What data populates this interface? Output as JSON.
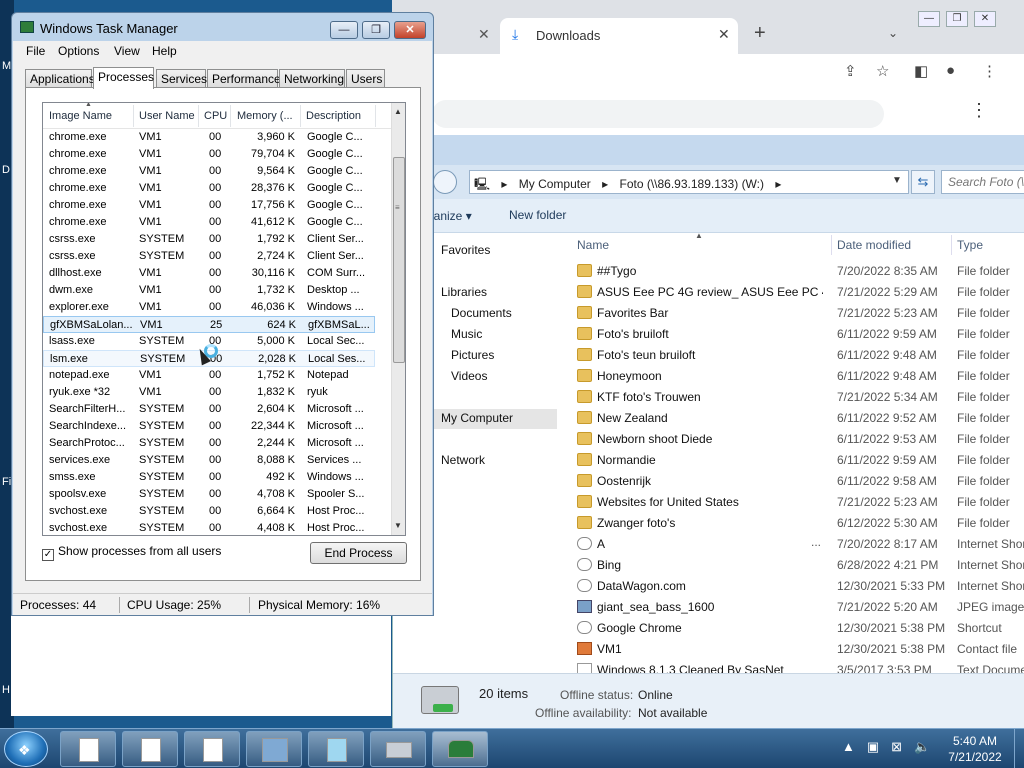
{
  "chrome": {
    "tab_title": "Downloads",
    "tab_close": "✕",
    "prev_tab_close": "✕",
    "new_tab": "+",
    "tab_menu": "⌄",
    "kebab": "⋮",
    "win_min": "—",
    "win_max": "❐",
    "win_close": "✕"
  },
  "explorer": {
    "breadcrumbs": [
      "My Computer",
      "▸",
      "Foto (\\\\86.93.189.133) (W:)",
      "▸"
    ],
    "breadcrumb_root_arrow": "▸",
    "search_placeholder": "Search Foto (\\\\...",
    "organize": "rganize ▾",
    "new_folder": "New folder",
    "nav": {
      "favorites": "Favorites",
      "libraries": "Libraries",
      "documents": "Documents",
      "music": "Music",
      "pictures": "Pictures",
      "videos": "Videos",
      "my_computer": "My Computer",
      "network": "Network"
    },
    "columns": {
      "name": "Name",
      "date": "Date modified",
      "type": "Type"
    },
    "files": [
      {
        "name": "##Tygo",
        "date": "7/20/2022 8:35 AM",
        "type": "File folder",
        "icon": "folder"
      },
      {
        "name": "ASUS Eee PC 4G review_ ASUS Eee PC 4G ...",
        "date": "7/21/2022 5:29 AM",
        "type": "File folder",
        "icon": "folder"
      },
      {
        "name": "Favorites Bar",
        "date": "7/21/2022 5:23 AM",
        "type": "File folder",
        "icon": "folder"
      },
      {
        "name": "Foto's bruiloft",
        "date": "6/11/2022 9:59 AM",
        "type": "File folder",
        "icon": "folder"
      },
      {
        "name": "Foto's teun bruiloft",
        "date": "6/11/2022 9:48 AM",
        "type": "File folder",
        "icon": "folder"
      },
      {
        "name": "Honeymoon",
        "date": "6/11/2022 9:48 AM",
        "type": "File folder",
        "icon": "folder"
      },
      {
        "name": "KTF foto's Trouwen",
        "date": "7/21/2022 5:34 AM",
        "type": "File folder",
        "icon": "folder"
      },
      {
        "name": "New Zealand",
        "date": "6/11/2022 9:52 AM",
        "type": "File folder",
        "icon": "folder"
      },
      {
        "name": "Newborn shoot Diede",
        "date": "6/11/2022 9:53 AM",
        "type": "File folder",
        "icon": "folder"
      },
      {
        "name": "Normandie",
        "date": "6/11/2022 9:59 AM",
        "type": "File folder",
        "icon": "folder"
      },
      {
        "name": "Oostenrijk",
        "date": "6/11/2022 9:58 AM",
        "type": "File folder",
        "icon": "folder"
      },
      {
        "name": "Websites for United States",
        "date": "7/21/2022 5:23 AM",
        "type": "File folder",
        "icon": "folder"
      },
      {
        "name": "Zwanger foto's",
        "date": "6/12/2022 5:30 AM",
        "type": "File folder",
        "icon": "folder"
      },
      {
        "name": "A",
        "date": "7/20/2022 8:17 AM",
        "type": "Internet Shor",
        "icon": "link",
        "more": "..."
      },
      {
        "name": "Bing",
        "date": "6/28/2022 4:21 PM",
        "type": "Internet Shor",
        "icon": "link"
      },
      {
        "name": "DataWagon.com",
        "date": "12/30/2021 5:33 PM",
        "type": "Internet Shor",
        "icon": "link"
      },
      {
        "name": "giant_sea_bass_1600",
        "date": "7/21/2022 5:20 AM",
        "type": "JPEG image",
        "icon": "img"
      },
      {
        "name": "Google Chrome",
        "date": "12/30/2021 5:38 PM",
        "type": "Shortcut",
        "icon": "link"
      },
      {
        "name": "VM1",
        "date": "12/30/2021 5:38 PM",
        "type": "Contact file",
        "icon": "contact"
      },
      {
        "name": "Windows 8.1.3 Cleaned By SasNet",
        "date": "3/5/2017 3:53 PM",
        "type": "Text Docume",
        "icon": "doc"
      }
    ],
    "details": {
      "count": "20 items",
      "offline_status_label": "Offline status:",
      "offline_status_value": "Online",
      "offline_avail_label": "Offline availability:",
      "offline_avail_value": "Not available"
    }
  },
  "taskmgr": {
    "title": "Windows Task Manager",
    "win_min": "—",
    "win_max": "❐",
    "win_close": "✕",
    "menu": [
      "File",
      "Options",
      "View",
      "Help"
    ],
    "tabs": [
      "Applications",
      "Processes",
      "Services",
      "Performance",
      "Networking",
      "Users"
    ],
    "columns": [
      "Image Name",
      "User Name",
      "CPU",
      "Memory (...",
      "Description"
    ],
    "processes": [
      [
        "chrome.exe",
        "VM1",
        "00",
        "3,960 K",
        "Google C..."
      ],
      [
        "chrome.exe",
        "VM1",
        "00",
        "79,704 K",
        "Google C..."
      ],
      [
        "chrome.exe",
        "VM1",
        "00",
        "9,564 K",
        "Google C..."
      ],
      [
        "chrome.exe",
        "VM1",
        "00",
        "28,376 K",
        "Google C..."
      ],
      [
        "chrome.exe",
        "VM1",
        "00",
        "17,756 K",
        "Google C..."
      ],
      [
        "chrome.exe",
        "VM1",
        "00",
        "41,612 K",
        "Google C..."
      ],
      [
        "csrss.exe",
        "SYSTEM",
        "00",
        "1,792 K",
        "Client Ser..."
      ],
      [
        "csrss.exe",
        "SYSTEM",
        "00",
        "2,724 K",
        "Client Ser..."
      ],
      [
        "dllhost.exe",
        "VM1",
        "00",
        "30,116 K",
        "COM Surr..."
      ],
      [
        "dwm.exe",
        "VM1",
        "00",
        "1,732 K",
        "Desktop ..."
      ],
      [
        "explorer.exe",
        "VM1",
        "00",
        "46,036 K",
        "Windows ..."
      ],
      [
        "gfXBMSaLolan...",
        "VM1",
        "25",
        "624 K",
        "gfXBMSaL..."
      ],
      [
        "lsass.exe",
        "SYSTEM",
        "00",
        "5,000 K",
        "Local Sec..."
      ],
      [
        "lsm.exe",
        "SYSTEM",
        "00",
        "2,028 K",
        "Local Ses..."
      ],
      [
        "notepad.exe",
        "VM1",
        "00",
        "1,752 K",
        "Notepad"
      ],
      [
        "ryuk.exe *32",
        "VM1",
        "00",
        "1,832 K",
        "ryuk"
      ],
      [
        "SearchFilterH...",
        "SYSTEM",
        "00",
        "2,604 K",
        "Microsoft ..."
      ],
      [
        "SearchIndexe...",
        "SYSTEM",
        "00",
        "22,344 K",
        "Microsoft ..."
      ],
      [
        "SearchProtoc...",
        "SYSTEM",
        "00",
        "2,244 K",
        "Microsoft ..."
      ],
      [
        "services.exe",
        "SYSTEM",
        "00",
        "8,088 K",
        "Services ..."
      ],
      [
        "smss.exe",
        "SYSTEM",
        "00",
        "492 K",
        "Windows ..."
      ],
      [
        "spoolsv.exe",
        "SYSTEM",
        "00",
        "4,708 K",
        "Spooler S..."
      ],
      [
        "svchost.exe",
        "SYSTEM",
        "00",
        "6,664 K",
        "Host Proc..."
      ],
      [
        "svchost.exe",
        "SYSTEM",
        "00",
        "4,408 K",
        "Host Proc..."
      ]
    ],
    "show_all_label": "Show processes from all users",
    "show_all_checked": "✓",
    "end_process": "End Process",
    "status": {
      "processes": "Processes: 44",
      "cpu": "CPU Usage: 25%",
      "memory": "Physical Memory: 16%"
    }
  },
  "desktop_chars": [
    "M",
    "D",
    "Fi",
    "H"
  ],
  "taskbar": {
    "clock_time": "5:40 AM",
    "clock_date": "7/21/2022",
    "tray_icons": [
      "▲",
      "▣",
      "⊠",
      "🔈"
    ],
    "start_flag": "❖"
  }
}
